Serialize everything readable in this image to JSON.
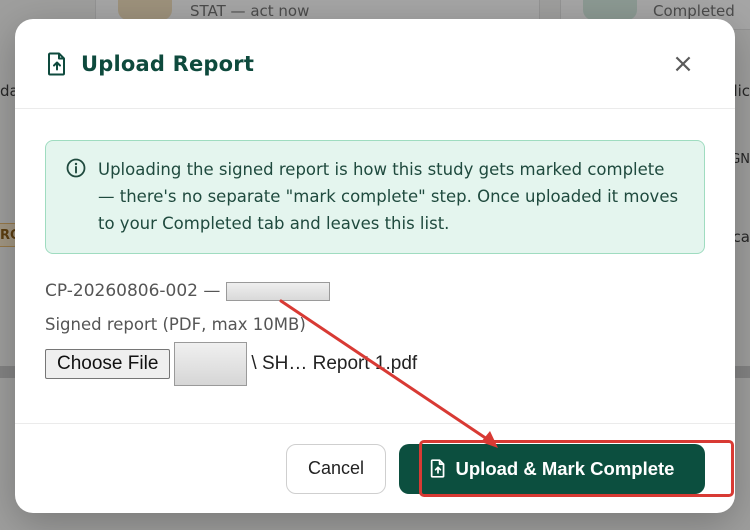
{
  "background": {
    "stat_text": "STAT — act now",
    "completed_text": "Completed",
    "left_fragments": [
      "da",
      "RO"
    ],
    "right_fragments": [
      "dic",
      "GN",
      "ca"
    ]
  },
  "modal": {
    "title": "Upload Report",
    "title_icon": "file-upload-icon",
    "close_icon": "close-icon",
    "close_glyph": "×",
    "info": {
      "icon": "info-icon",
      "text": "Uploading the signed report is how this study gets marked complete — there's no separate \"mark complete\" step. Once uploaded it moves to your Completed tab and leaves this list."
    },
    "study_id": "CP-20260806-002 —",
    "field_label": "Signed report (PDF, max 10MB)",
    "file_input": {
      "button_label": "Choose File",
      "file_name": "\\ SH… Report 1.pdf"
    },
    "footer": {
      "cancel_label": "Cancel",
      "primary_label": "Upload & Mark Complete",
      "primary_icon": "file-upload-icon"
    }
  },
  "colors": {
    "brand_green": "#0c4f3f",
    "title_green": "#0e4a3d",
    "info_bg": "#e4f5ee",
    "info_border": "#9fdcc0",
    "annotation_red": "#d83a34"
  }
}
